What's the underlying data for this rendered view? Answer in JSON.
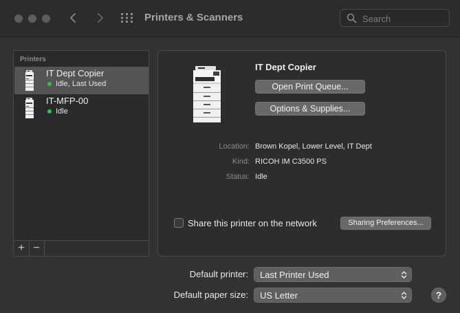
{
  "window": {
    "title": "Printers & Scanners",
    "search_placeholder": "Search"
  },
  "sidebar": {
    "header": "Printers",
    "printers": [
      {
        "name": "IT Dept Copier",
        "status": "Idle, Last Used",
        "selected": true,
        "status_color": "#2dc24a"
      },
      {
        "name": "IT-MFP-00",
        "status": "Idle",
        "selected": false,
        "status_color": "#2dc24a"
      }
    ],
    "add_label": "+",
    "remove_label": "−"
  },
  "detail": {
    "printer_name": "IT Dept Copier",
    "open_queue_label": "Open Print Queue...",
    "options_label": "Options & Supplies...",
    "info": [
      {
        "label": "Location:",
        "value": "Brown Kopel, Lower Level, IT Dept"
      },
      {
        "label": "Kind:",
        "value": "RICOH IM C3500 PS"
      },
      {
        "label": "Status:",
        "value": "Idle"
      }
    ],
    "share_label": "Share this printer on the network",
    "share_checked": false,
    "sharing_prefs_label": "Sharing Preferences..."
  },
  "defaults": {
    "printer_label": "Default printer:",
    "printer_value": "Last Printer Used",
    "paper_label": "Default paper size:",
    "paper_value": "US Letter"
  },
  "help_label": "?",
  "icons": {
    "close": "traffic-light-close",
    "minimize": "traffic-light-minimize",
    "maximize": "traffic-light-maximize",
    "back": "chevron-left-icon",
    "forward": "chevron-right-icon",
    "show_all": "grid-icon",
    "search": "magnifier-icon",
    "printer": "printer-icon",
    "popup": "up-down-chevron-icon"
  }
}
